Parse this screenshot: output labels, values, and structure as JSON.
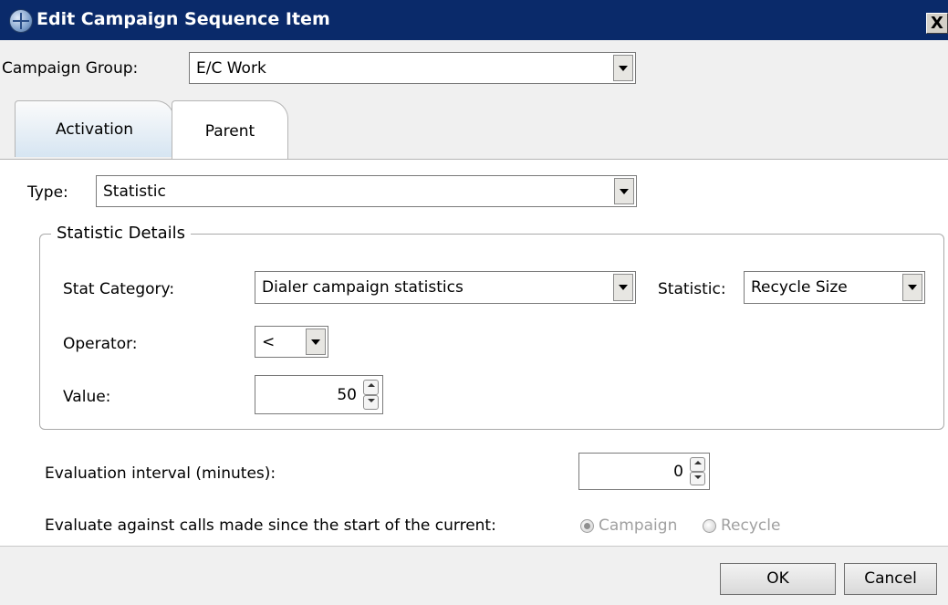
{
  "window": {
    "title": "Edit Campaign Sequence Item",
    "close_label": "X"
  },
  "campaign_group": {
    "label": "Campaign Group:",
    "value": "E/C Work"
  },
  "tabs": [
    {
      "label": "Activation"
    },
    {
      "label": "Parent"
    }
  ],
  "type": {
    "label": "Type:",
    "value": "Statistic"
  },
  "statistic_details": {
    "title": "Statistic Details",
    "stat_category": {
      "label": "Stat Category:",
      "value": "Dialer campaign statistics"
    },
    "statistic": {
      "label": "Statistic:",
      "value": "Recycle Size"
    },
    "operator": {
      "label": "Operator:",
      "value": "<"
    },
    "value": {
      "label": "Value:",
      "value": "50"
    }
  },
  "evaluation_interval": {
    "label": "Evaluation interval (minutes):",
    "value": "0"
  },
  "evaluate_against": {
    "label": "Evaluate against calls made since the start of the current:",
    "options": [
      {
        "label": "Campaign",
        "checked": true
      },
      {
        "label": "Recycle",
        "checked": false
      }
    ]
  },
  "buttons": {
    "ok": "OK",
    "cancel": "Cancel"
  }
}
